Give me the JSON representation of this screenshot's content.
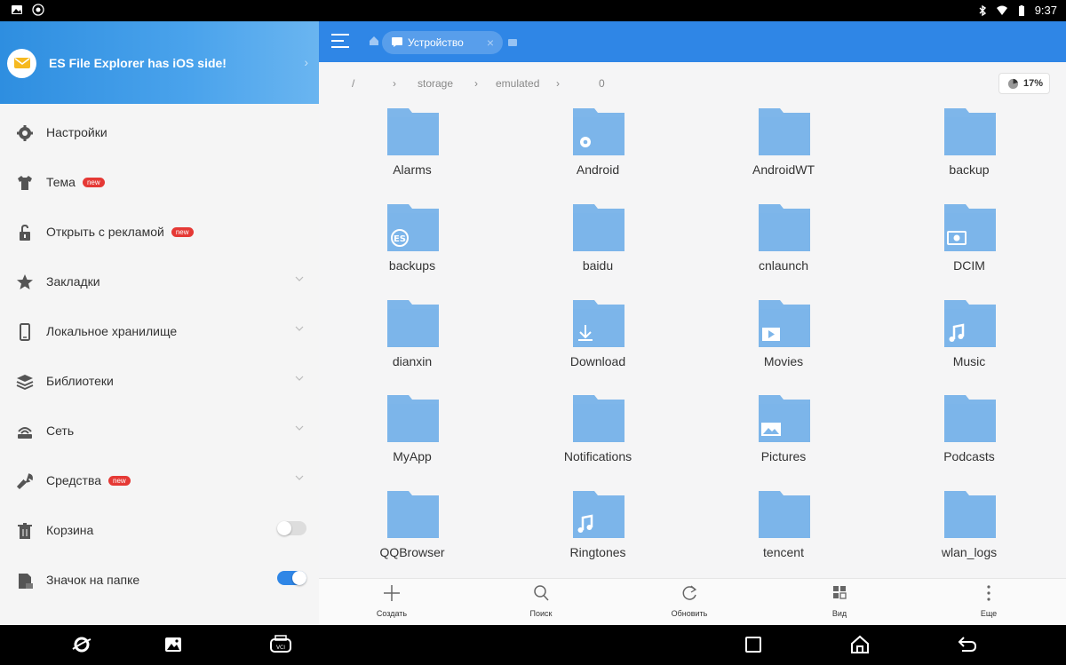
{
  "status_bar": {
    "time": "9:37"
  },
  "drawer": {
    "promo_text": "ES File Explorer has iOS side!",
    "items": [
      {
        "label": "Настройки",
        "icon": "gear-icon"
      },
      {
        "label": "Тема",
        "badge": "new",
        "icon": "shirt-icon"
      },
      {
        "label": "Открыть с рекламой",
        "badge": "new",
        "icon": "lock-open-icon"
      },
      {
        "label": "Закладки",
        "icon": "star-icon",
        "expandable": true
      },
      {
        "label": "Локальное хранилище",
        "icon": "phone-icon",
        "expandable": true
      },
      {
        "label": "Библиотеки",
        "icon": "layers-icon",
        "expandable": true
      },
      {
        "label": "Сеть",
        "icon": "network-icon",
        "expandable": true
      },
      {
        "label": "Средства",
        "badge": "new",
        "icon": "wrench-icon",
        "expandable": true
      },
      {
        "label": "Корзина",
        "icon": "trash-icon",
        "toggle": false
      },
      {
        "label": "Значок на папке",
        "icon": "folder-badge-icon",
        "toggle": true
      }
    ]
  },
  "toolbar": {
    "tab_label": "Устройство"
  },
  "breadcrumb": [
    "/",
    "storage",
    "emulated",
    "0"
  ],
  "storage_usage": "17%",
  "folders": [
    {
      "name": "Alarms",
      "overlay": ""
    },
    {
      "name": "Android",
      "overlay": "gear-icon"
    },
    {
      "name": "AndroidWT",
      "overlay": ""
    },
    {
      "name": "backup",
      "overlay": ""
    },
    {
      "name": "backups",
      "overlay": "es-logo-icon"
    },
    {
      "name": "baidu",
      "overlay": ""
    },
    {
      "name": "cnlaunch",
      "overlay": ""
    },
    {
      "name": "DCIM",
      "overlay": "camera-icon"
    },
    {
      "name": "dianxin",
      "overlay": ""
    },
    {
      "name": "Download",
      "overlay": "download-icon"
    },
    {
      "name": "Movies",
      "overlay": "play-icon"
    },
    {
      "name": "Music",
      "overlay": "music-note-icon"
    },
    {
      "name": "MyApp",
      "overlay": ""
    },
    {
      "name": "Notifications",
      "overlay": ""
    },
    {
      "name": "Pictures",
      "overlay": "image-icon"
    },
    {
      "name": "Podcasts",
      "overlay": ""
    },
    {
      "name": "QQBrowser",
      "overlay": ""
    },
    {
      "name": "Ringtones",
      "overlay": "music-note-icon"
    },
    {
      "name": "tencent",
      "overlay": ""
    },
    {
      "name": "wlan_logs",
      "overlay": ""
    }
  ],
  "actions": [
    {
      "label": "Создать",
      "icon": "plus-icon"
    },
    {
      "label": "Поиск",
      "icon": "search-icon"
    },
    {
      "label": "Обновить",
      "icon": "refresh-icon"
    },
    {
      "label": "Вид",
      "icon": "grid-view-icon"
    },
    {
      "label": "Еще",
      "icon": "more-vert-icon"
    }
  ],
  "colors": {
    "accent": "#2f86e6",
    "folder": "#7eb6ea",
    "badge": "#e53935"
  }
}
